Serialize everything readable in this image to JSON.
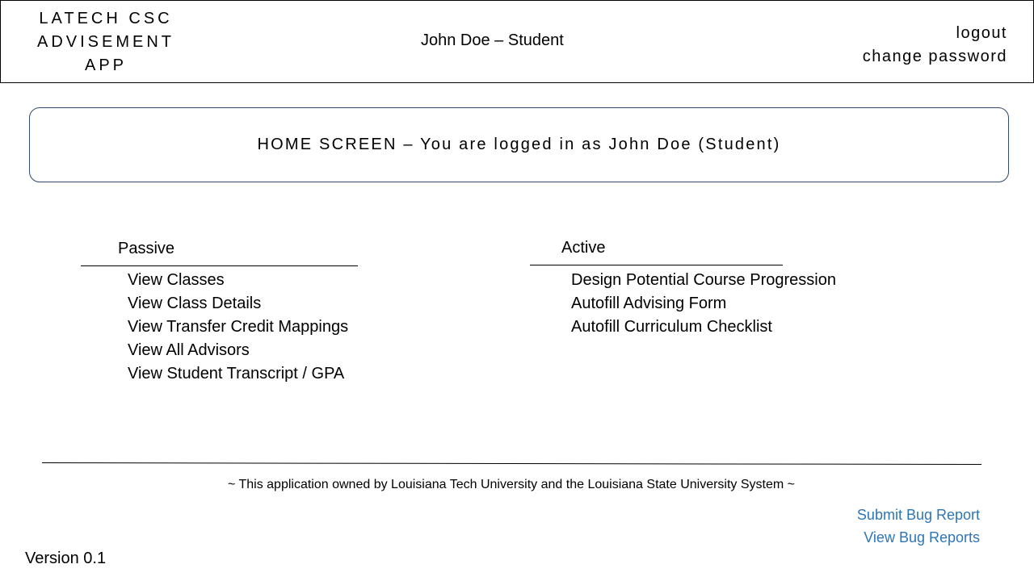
{
  "header": {
    "app_title_lines": [
      "LATECH CSC",
      "ADVISEMENT",
      "APP"
    ],
    "user_display": "John Doe – Student",
    "logout_label": "logout",
    "change_password_label": "change password"
  },
  "banner": {
    "text": "HOME SCREEN – You are logged in as John Doe (Student)"
  },
  "passive": {
    "heading": "Passive",
    "items": [
      "View Classes",
      "View Class Details",
      "View Transfer Credit Mappings",
      "View All Advisors",
      "View Student Transcript / GPA"
    ]
  },
  "active": {
    "heading": "Active",
    "items": [
      "Design Potential Course Progression",
      "Autofill Advising Form",
      "Autofill Curriculum Checklist"
    ]
  },
  "footer": {
    "ownership_text": "~ This application owned by Louisiana Tech University and the Louisiana State University System ~",
    "submit_bug_label": "Submit Bug Report",
    "view_bugs_label": "View Bug Reports",
    "version": "Version 0.1",
    "link_color": "#2e75b6"
  }
}
